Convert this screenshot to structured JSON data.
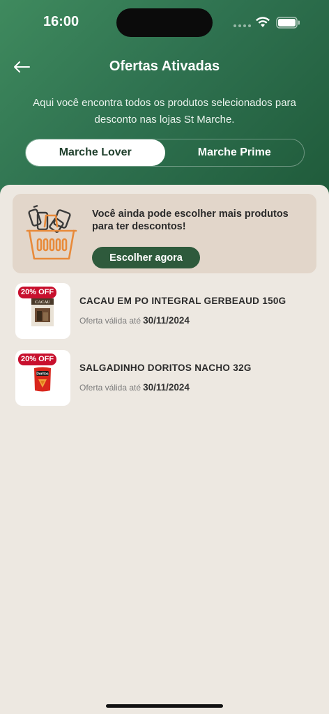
{
  "status_bar": {
    "time": "16:00"
  },
  "header": {
    "title": "Ofertas Ativadas",
    "subtitle": "Aqui você encontra todos os produtos  selecionados para desconto nas lojas St Marche."
  },
  "tabs": [
    {
      "label": "Marche Lover",
      "active": true
    },
    {
      "label": "Marche Prime",
      "active": false
    }
  ],
  "promo": {
    "text": "Você ainda pode escolher mais produtos para ter descontos!",
    "button_label": "Escolher agora"
  },
  "products": [
    {
      "badge": "20% OFF",
      "name": "CACAU EM PO INTEGRAL GERBEAUD 150G",
      "validity_label": "Oferta válida até",
      "validity_date": "30/11/2024",
      "image_text": "CACAU"
    },
    {
      "badge": "20% OFF",
      "name": "SALGADINHO DORITOS NACHO 32G",
      "validity_label": "Oferta válida até",
      "validity_date": "30/11/2024",
      "image_text": "Doritos"
    }
  ],
  "colors": {
    "header_green": "#2f7250",
    "button_green": "#2e5a3c",
    "badge_red": "#c8102e",
    "basket_orange": "#e88a3a",
    "background": "#ede8e1"
  }
}
